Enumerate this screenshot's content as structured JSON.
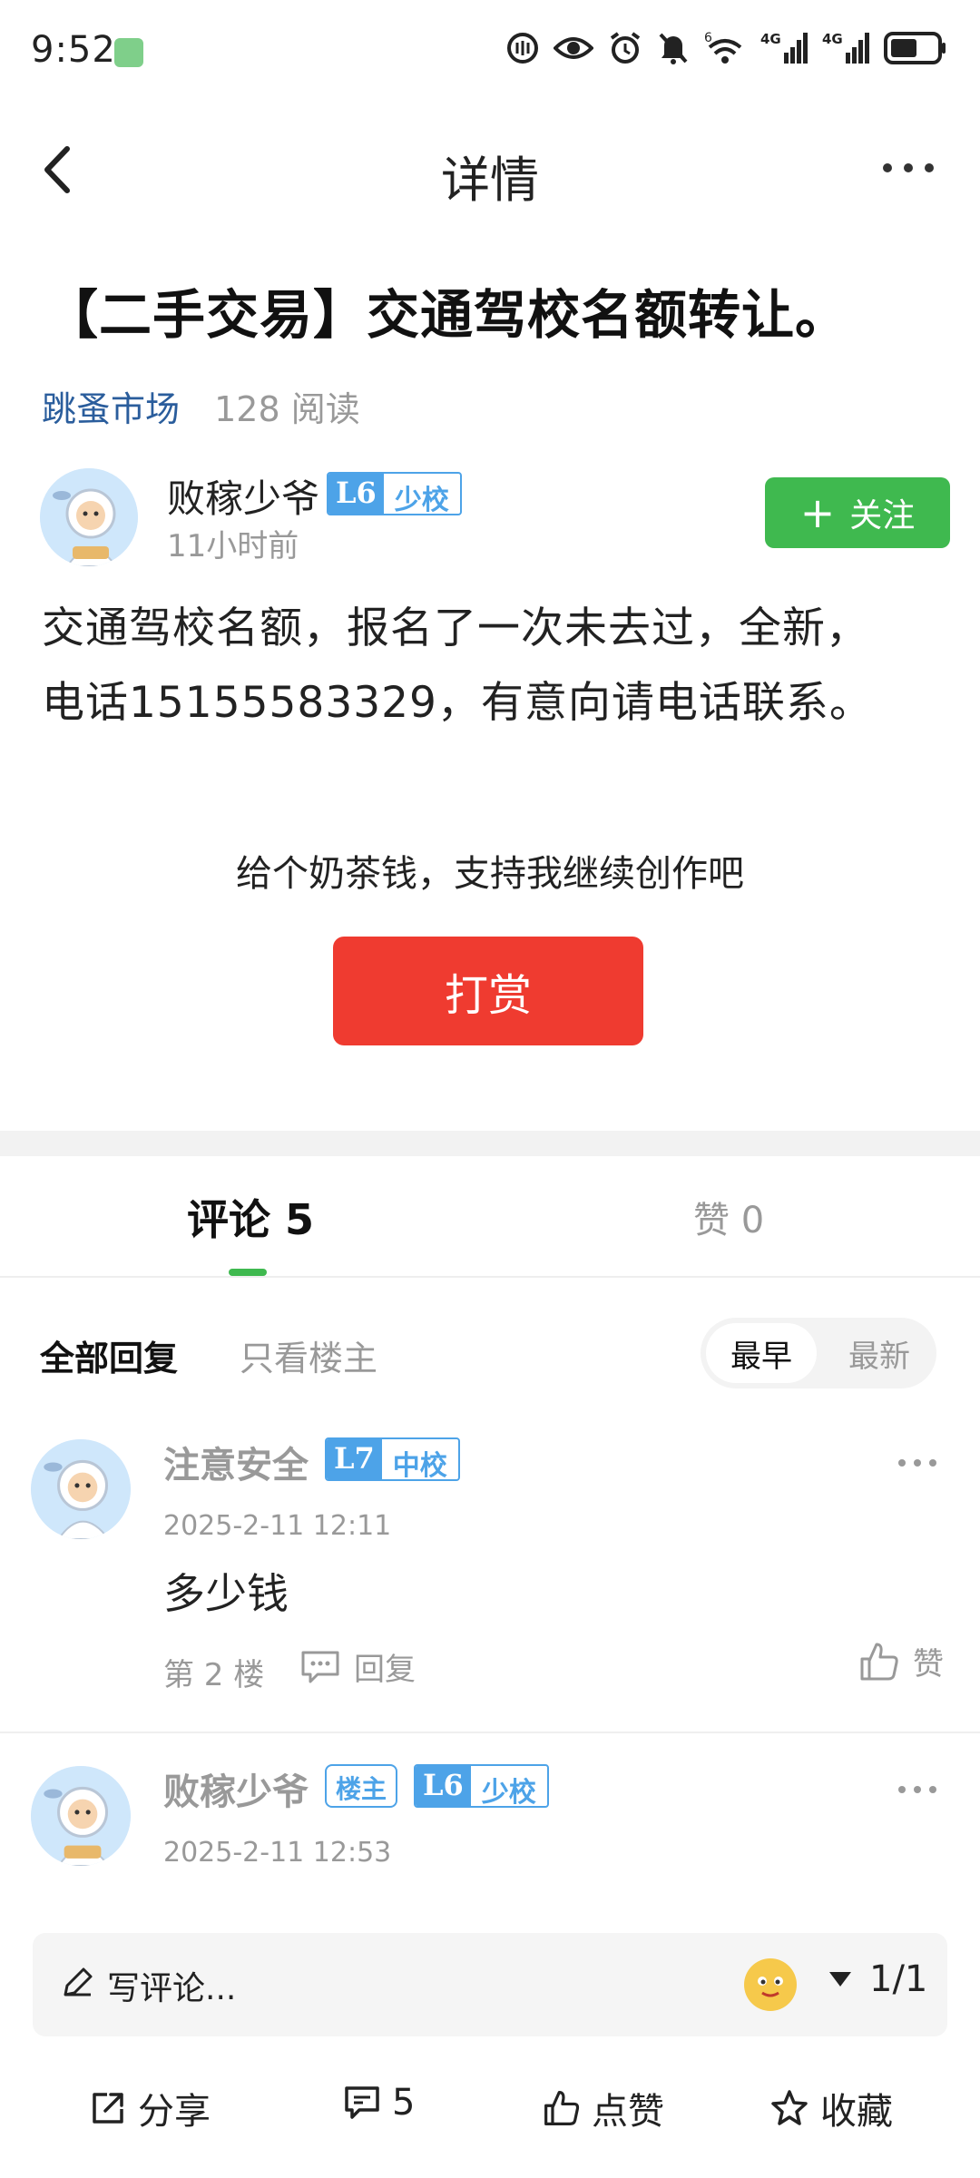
{
  "status_bar": {
    "time": "9:52",
    "icons": [
      "app-notification-icon",
      "nfc-icon",
      "eye-icon",
      "alarm-icon",
      "mute-icon",
      "wifi-icon",
      "signal-4g-icon",
      "signal-4g-icon",
      "battery-icon"
    ],
    "wifi_label": "6",
    "net1": "4G",
    "net2": "4G"
  },
  "nav": {
    "title": "详情"
  },
  "post": {
    "title": "【二手交易】交通驾校名额转让。",
    "category": "跳蚤市场",
    "reads": "128 阅读",
    "author": {
      "name": "败稼少爷",
      "level": "L6",
      "rank": "少校",
      "time": "11小时前"
    },
    "follow_label": "关注",
    "body_line1": "交通驾校名额，报名了一次未去过，全新，",
    "body_line2": "电话15155583329，有意向请电话联系。",
    "tip_text": "给个奶茶钱，支持我继续创作吧",
    "tip_button": "打赏"
  },
  "tabs": {
    "comments": "评论 5",
    "likes": "赞 0"
  },
  "filter": {
    "all": "全部回复",
    "op_only": "只看楼主",
    "sort_early": "最早",
    "sort_late": "最新"
  },
  "comments": [
    {
      "name": "注意安全",
      "level": "L7",
      "rank": "中校",
      "time": "2025-2-11 12:11",
      "text": "多少钱",
      "floor": "第 2 楼",
      "reply": "回复",
      "like": "赞"
    },
    {
      "name": "败稼少爷",
      "op_tag": "楼主",
      "level": "L6",
      "rank": "少校",
      "time": "2025-2-11 12:53"
    }
  ],
  "bottom": {
    "write_placeholder": "写评论...",
    "page_indicator": "1/1",
    "share": "分享",
    "comment_count": "5",
    "like": "点赞",
    "favorite": "收藏"
  },
  "colors": {
    "accent_green": "#3fb94f",
    "tip_red": "#ef3b30",
    "badge_blue": "#4da3e8",
    "category_blue": "#2a5d9c"
  }
}
